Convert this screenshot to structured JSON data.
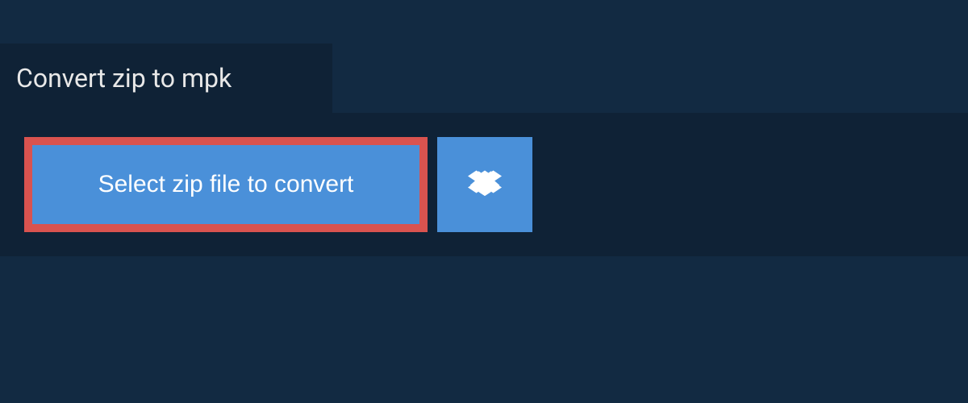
{
  "header": {
    "title": "Convert zip to mpk"
  },
  "actions": {
    "select_label": "Select zip file to convert",
    "dropbox_label": "Dropbox"
  },
  "colors": {
    "background": "#122a42",
    "panel": "#0f2236",
    "button_bg": "#4a90d9",
    "button_border": "#d9534f",
    "text_light": "#ffffff"
  }
}
